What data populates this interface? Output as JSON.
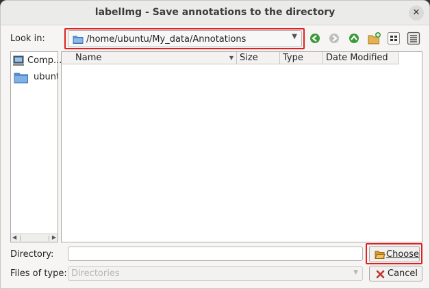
{
  "window": {
    "title": "labelImg - Save annotations to the directory",
    "close_glyph": "✕"
  },
  "look_in": {
    "label": "Look in:",
    "path": "/home/ubuntu/My_data/Annotations",
    "dropdown_glyph": "▼"
  },
  "toolbar": {
    "icons": [
      "back-icon",
      "forward-icon",
      "up-folder-icon",
      "new-folder-icon",
      "list-view-icon",
      "details-view-icon"
    ]
  },
  "sidebar": {
    "items": [
      {
        "label": "Comp...",
        "icon": "computer-icon"
      },
      {
        "label": "ubuntu",
        "icon": "folder-icon"
      }
    ],
    "scroll_left": "◀",
    "scroll_right": "▶"
  },
  "file_table": {
    "columns": [
      "Name",
      "Size",
      "Type",
      "Date Modified"
    ],
    "sort_glyph": "▼",
    "rows": []
  },
  "directory": {
    "label": "Directory:",
    "value": ""
  },
  "files_of_type": {
    "label": "Files of type:",
    "value": "Directories",
    "dropdown_glyph": "▼"
  },
  "buttons": {
    "choose": "Choose",
    "cancel": "Cancel"
  },
  "colors": {
    "highlight": "#e02020",
    "toolbar_green": "#3c9a3c"
  }
}
